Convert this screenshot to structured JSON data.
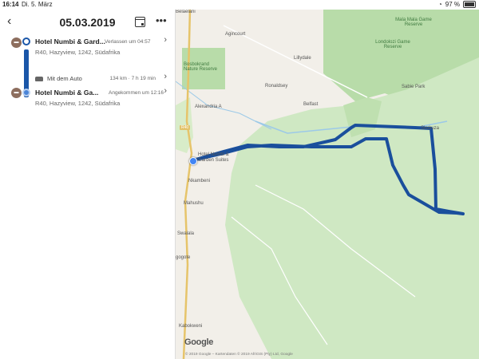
{
  "status_bar": {
    "time": "16:14",
    "date": "Di. 5. März",
    "battery": "97 %",
    "battery_level": 0.97
  },
  "header": {
    "back_label": "‹",
    "date": "05.03.2019",
    "more_label": "•••"
  },
  "timeline": [
    {
      "type": "place",
      "icon": "hotel-icon",
      "title": "Hotel Numbi & Gard...",
      "status": "Verlassen um 04:57",
      "address": "R40, Hazyview, 1242, Südafrika"
    },
    {
      "type": "travel",
      "icon": "car-icon",
      "label": "Mit dem Auto",
      "meta": "134 km · 7 h 19 min"
    },
    {
      "type": "place",
      "icon": "hotel-icon",
      "title": "Hotel Numbi & Ga...",
      "status": "Angekommen um 12:16",
      "address": "R40, Hazyview, 1242, Südafrika"
    }
  ],
  "map": {
    "labels": {
      "belaelani": "Belaelani",
      "agincourt": "Agincourt",
      "mala_mala": "Mala Mala Game Reserve",
      "londolozi": "Londolozi Game Reserve",
      "bosbokrand": "Bosbokrand Nature Reserve",
      "lillydale": "Lillydale",
      "ronaldsey": "Ronaldsey",
      "sabie_park": "Sabie Park",
      "alexandria": "Alexandria A",
      "belfast": "Belfast",
      "skukuza": "Skukuza",
      "hotel_marker": "Hotel Numbi & Garden Suites",
      "nkambeni": "Nkambeni",
      "mahushu": "Mahushu",
      "swalala": "Swalala",
      "gogote": "gogote",
      "kabokweni": "Kabokweni",
      "r40": "R40"
    },
    "logo": "Google",
    "attribution": "© 2019 Google – Kartendaten © 2019 AfriGIS (Pty) Ltd, Google",
    "colors": {
      "route": "#1a4f9c",
      "park": "#cfe8c3",
      "park_dark": "#a9d39a",
      "land": "#f2efe9"
    }
  }
}
